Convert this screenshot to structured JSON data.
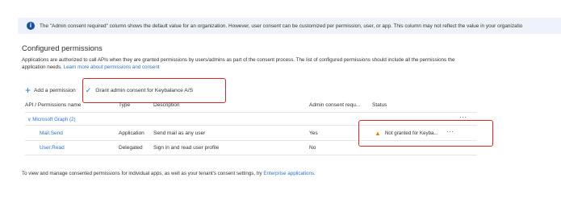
{
  "info_banner": {
    "icon": "info-icon",
    "text": "The \"Admin consent required\" column shows the default value for an organization. However, user consent can be customized per permission, user, or app. This column may not reflect the value in your organizatio"
  },
  "section": {
    "title": "Configured permissions",
    "description": "Applications are authorized to call APIs when they are granted permissions by users/admins as part of the consent process. The list of configured permissions should include all the permissions the application needs.",
    "learn_more": "Learn more about permissions and consent"
  },
  "toolbar": {
    "add_label": "Add a permission",
    "grant_label": "Grant admin consent for Keybalance A/S"
  },
  "table": {
    "headers": [
      "API / Permissions name",
      "Type",
      "Description",
      "Admin consent requ...",
      "Status"
    ],
    "group_label": "Microsoft Graph (2)",
    "rows": [
      {
        "name": "Mail.Send",
        "type": "Application",
        "description": "Send mail as any user",
        "admin_consent": "Yes",
        "status": "Not granted for Keyba..."
      },
      {
        "name": "User.Read",
        "type": "Delegated",
        "description": "Sign in and read user profile",
        "admin_consent": "No",
        "status": ""
      }
    ],
    "more_label": "···"
  },
  "footer": {
    "text": "To view and manage consented permissions for individual apps, as well as your tenant's consent settings, try",
    "link": "Enterprise applications."
  },
  "colors": {
    "accent": "#2b73c9",
    "highlight_box": "#d62828",
    "warning": "#d98d00",
    "banner_bg": "#eef3fb"
  }
}
